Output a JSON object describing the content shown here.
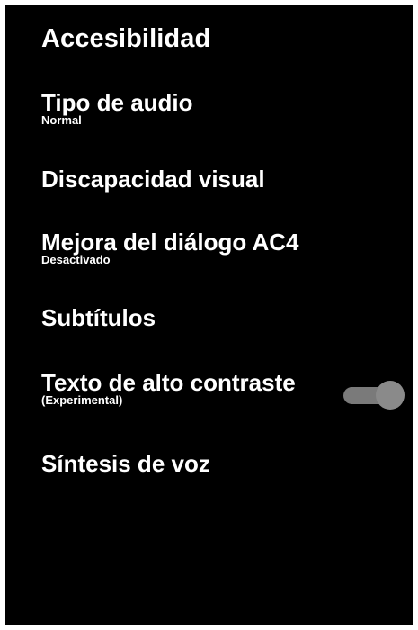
{
  "title": "Accesibilidad",
  "items": [
    {
      "label": "Tipo de audio",
      "sub": "Normal"
    },
    {
      "label": "Discapacidad visual",
      "sub": ""
    },
    {
      "label": "Mejora del diálogo AC4",
      "sub": "Desactivado"
    },
    {
      "label": "Subtítulos",
      "sub": ""
    },
    {
      "label": "Texto de alto contraste",
      "sub": "(Experimental)"
    },
    {
      "label": "Síntesis de voz",
      "sub": ""
    }
  ],
  "high_contrast_toggle": {
    "state": "off"
  },
  "colors": {
    "background": "#000000",
    "text": "#ffffff",
    "toggle_track": "#7a7a7a",
    "toggle_thumb": "#8a8a8a"
  }
}
